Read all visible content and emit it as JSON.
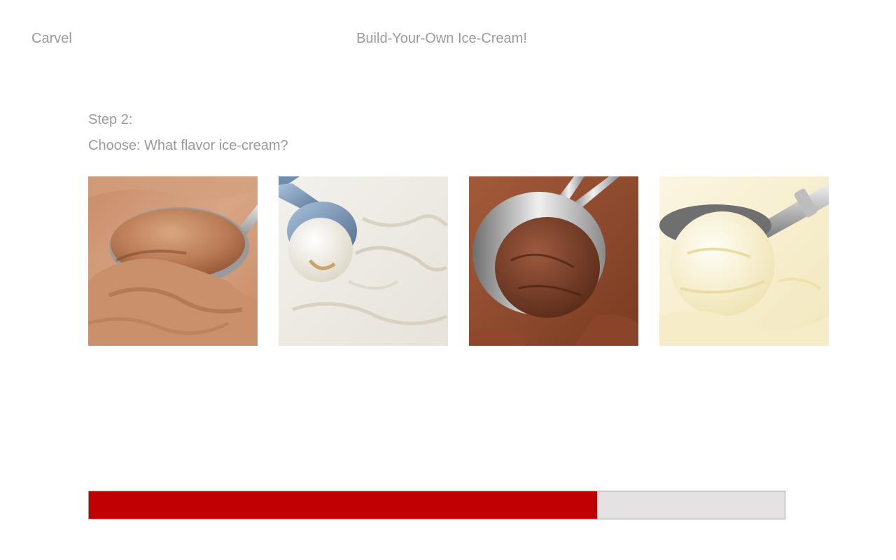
{
  "header": {
    "brand": "Carvel",
    "title": "Build-Your-Own Ice-Cream!"
  },
  "step": {
    "label": "Step 2:",
    "prompt": "Choose: What flavor ice-cream?"
  },
  "flavors": [
    {
      "image": "milk-chocolate-ice-cream-scoop"
    },
    {
      "image": "vanilla-cream-ice-cream-scoop"
    },
    {
      "image": "dark-chocolate-ice-cream-scoop"
    },
    {
      "image": "french-vanilla-ice-cream-scoop"
    }
  ],
  "progress": {
    "fraction": 0.73,
    "fill_color": "#c00000",
    "track_color": "#e4e2e2"
  },
  "colors": {
    "text": "#9b9b9b",
    "accent": "#c00000"
  }
}
